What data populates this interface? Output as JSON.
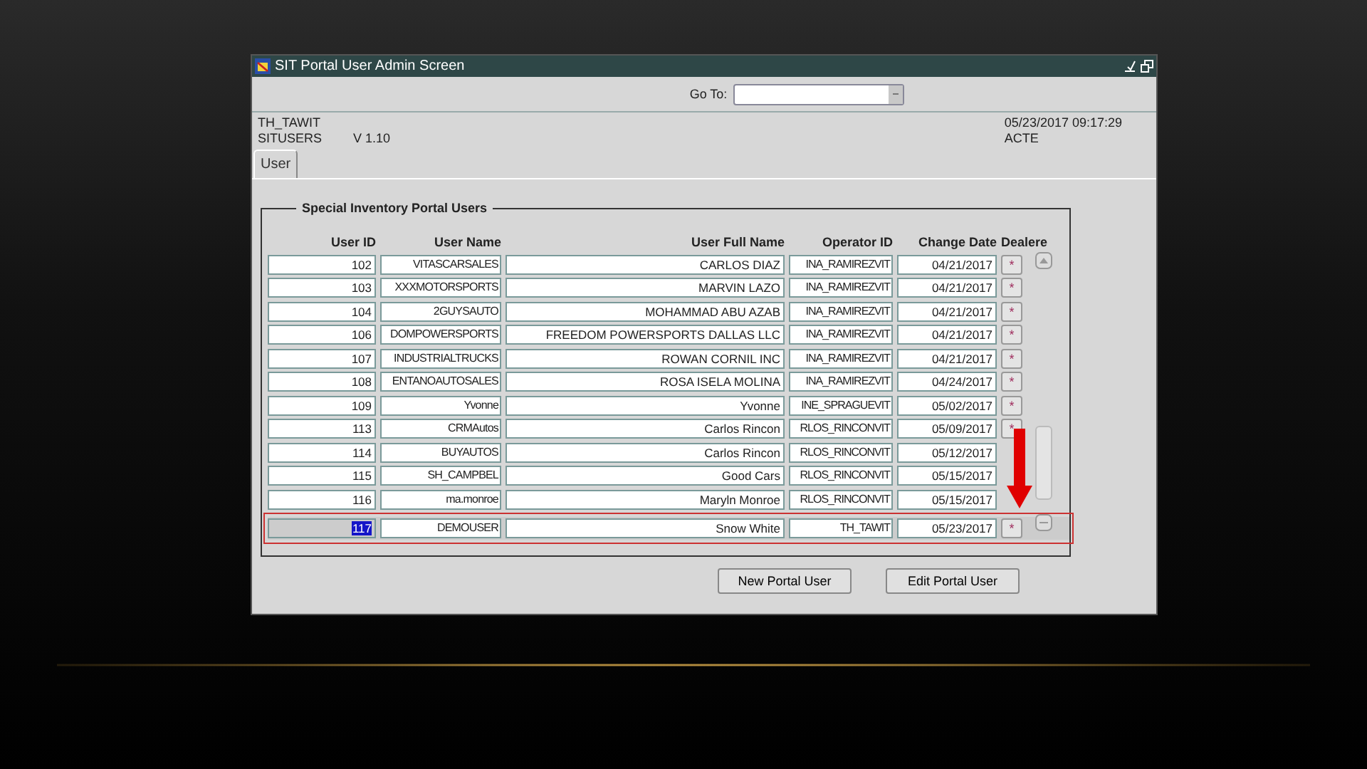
{
  "window": {
    "title": "SIT Portal User Admin Screen"
  },
  "goto": {
    "label": "Go To:"
  },
  "info": {
    "operator": "TH_TAWIT",
    "module": "SITUSERS",
    "version": "V 1.10",
    "datetime": "05/23/2017 09:17:29",
    "status": "ACTE"
  },
  "tabs": [
    {
      "label": "User",
      "selected": true
    }
  ],
  "panel": {
    "title": "Special Inventory Portal Users",
    "columns": [
      "User ID",
      "User Name",
      "User Full Name",
      "Operator ID",
      "Change Date",
      "Dealere"
    ],
    "rows": [
      {
        "id": "102",
        "user_name": "VITASCARSALES",
        "full_name": "CARLOS DIAZ",
        "operator": "INA_RAMIREZVIT",
        "date": "04/21/2017",
        "dealer": "*",
        "selected": false
      },
      {
        "id": "103",
        "user_name": "XXXMOTORSPORTS",
        "full_name": "MARVIN LAZO",
        "operator": "INA_RAMIREZVIT",
        "date": "04/21/2017",
        "dealer": "*",
        "selected": false
      },
      {
        "id": "104",
        "user_name": "2GUYSAUTO",
        "full_name": "MOHAMMAD ABU AZAB",
        "operator": "INA_RAMIREZVIT",
        "date": "04/21/2017",
        "dealer": "*",
        "selected": false
      },
      {
        "id": "106",
        "user_name": "DOMPOWERSPORTS",
        "full_name": "FREEDOM POWERSPORTS DALLAS LLC",
        "operator": "INA_RAMIREZVIT",
        "date": "04/21/2017",
        "dealer": "*",
        "selected": false
      },
      {
        "id": "107",
        "user_name": "INDUSTRIALTRUCKS",
        "full_name": "ROWAN CORNIL INC",
        "operator": "INA_RAMIREZVIT",
        "date": "04/21/2017",
        "dealer": "*",
        "selected": false
      },
      {
        "id": "108",
        "user_name": "ENTANOAUTOSALES",
        "full_name": "ROSA ISELA MOLINA",
        "operator": "INA_RAMIREZVIT",
        "date": "04/24/2017",
        "dealer": "*",
        "selected": false
      },
      {
        "id": "109",
        "user_name": "Yvonne",
        "full_name": "Yvonne",
        "operator": "INE_SPRAGUEVIT",
        "date": "05/02/2017",
        "dealer": "*",
        "selected": false
      },
      {
        "id": "113",
        "user_name": "CRMAutos",
        "full_name": "Carlos Rincon",
        "operator": "RLOS_RINCONVIT",
        "date": "05/09/2017",
        "dealer": "*",
        "selected": false
      },
      {
        "id": "114",
        "user_name": "BUYAUTOS",
        "full_name": "Carlos Rincon",
        "operator": "RLOS_RINCONVIT",
        "date": "05/12/2017",
        "selected": false
      },
      {
        "id": "115",
        "user_name": "SH_CAMPBEL",
        "full_name": "Good Cars",
        "operator": "RLOS_RINCONVIT",
        "date": "05/15/2017",
        "selected": false
      },
      {
        "id": "116",
        "user_name": "ma.monroe",
        "full_name": "Maryln Monroe",
        "operator": "RLOS_RINCONVIT",
        "date": "05/15/2017",
        "selected": false
      },
      {
        "id": "117",
        "user_name": "DEMOUSER",
        "full_name": "Snow White",
        "operator": "TH_TAWIT",
        "date": "05/23/2017",
        "dealer": "*",
        "selected": true
      }
    ]
  },
  "buttons": [
    "New Portal User",
    "Edit Portal User"
  ]
}
